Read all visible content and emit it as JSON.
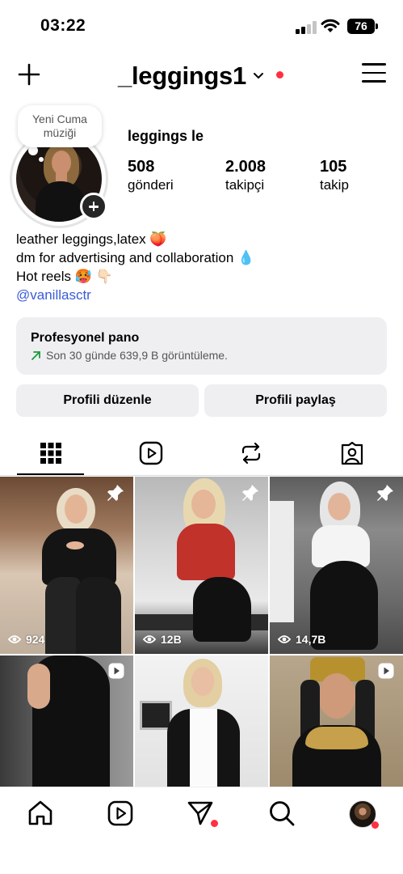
{
  "status_bar": {
    "time": "03:22",
    "battery": "76",
    "icons": [
      "cellular-signal-icon",
      "wifi-icon",
      "battery-icon"
    ]
  },
  "header": {
    "username": "_leggings1",
    "icons": [
      "plus-icon",
      "chevron-down-icon",
      "hamburger-menu-icon"
    ],
    "notification_dot_color": "#ff3040"
  },
  "profile": {
    "note": "Yeni Cuma müziği",
    "display_name": "leggings le",
    "stats": [
      {
        "value": "508",
        "label": "gönderi"
      },
      {
        "value": "2.008",
        "label": "takipçi"
      },
      {
        "value": "105",
        "label": "takip"
      }
    ],
    "bio": [
      "leather leggings,latex 🍑",
      "dm for advertising and collaboration 💧",
      "Hot reels 🥵 👇🏻"
    ],
    "link": "@vanillasctr",
    "link_color": "#3b5bd6"
  },
  "pro_dashboard": {
    "title": "Profesyonel pano",
    "subtitle": "Son 30 günde 639,9 B görüntüleme.",
    "trend_icon": "up-right-arrow-icon",
    "trend_color": "#1a9b3b"
  },
  "buttons": {
    "edit": "Profili düzenle",
    "share": "Profili paylaş"
  },
  "tabs": [
    "grid-icon",
    "reels-icon",
    "reposts-icon",
    "tagged-icon"
  ],
  "active_tab": "grid",
  "posts": [
    {
      "views": "924",
      "badge": "pin-icon"
    },
    {
      "views": "12B",
      "badge": "pin-icon"
    },
    {
      "views": "14,7B",
      "badge": "pin-icon"
    },
    {
      "views": "",
      "badge": "reel-icon"
    },
    {
      "views": "",
      "badge": ""
    },
    {
      "views": "",
      "badge": "reel-icon"
    }
  ],
  "bottom_nav": [
    "home-icon",
    "reels-icon",
    "direct-message-icon",
    "search-icon",
    "profile-avatar"
  ]
}
